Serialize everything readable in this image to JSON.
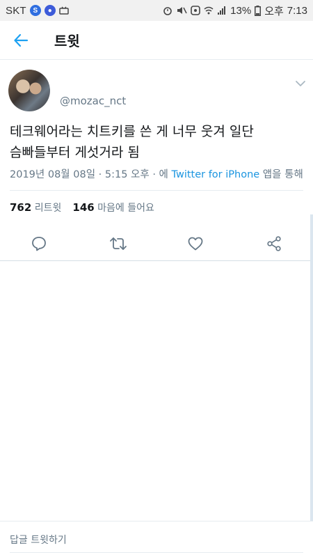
{
  "statusbar": {
    "carrier": "SKT",
    "battery": "13%",
    "ampm": "오후",
    "time": "7:13"
  },
  "header": {
    "title": "트윗",
    "icons": {
      "back": "arrow-left-icon"
    }
  },
  "tweet": {
    "handle": "@mozac_nct",
    "text_line1": "테크웨어라는 치트키를 쓴 게 너무 웃겨 일단",
    "text_line2": "슴빠들부터 게섯거라 됨",
    "date": "2019년 08월 08일 · 5:15 오후 · 에 ",
    "source": "Twitter for iPhone",
    "source_suffix": " 앱을 통해",
    "retweet_count": "762",
    "retweet_label": "리트윗",
    "like_count": "146",
    "like_label": "마음에 들어요"
  },
  "actions": {
    "icons": [
      "reply-icon",
      "retweet-icon",
      "like-icon",
      "share-icon"
    ]
  },
  "reply": {
    "placeholder": "답글 트윗하기"
  },
  "colors": {
    "accent": "#1da1f2",
    "secondary_text": "#657786",
    "link": "#1b95e0"
  }
}
